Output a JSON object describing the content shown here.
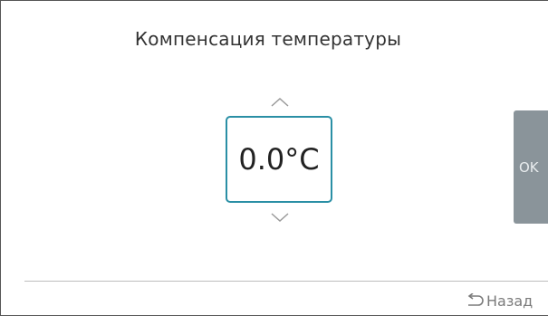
{
  "screen": {
    "title": "Компенсация температуры"
  },
  "stepper": {
    "value": "0.0°C",
    "up_icon": "chevron-up-icon",
    "down_icon": "chevron-down-icon"
  },
  "actions": {
    "ok_label": "OK",
    "back_label": "Назад",
    "back_icon": "back-arrow-icon"
  },
  "colors": {
    "accent": "#2a8fa5",
    "ok_button_bg": "#8a949a"
  }
}
